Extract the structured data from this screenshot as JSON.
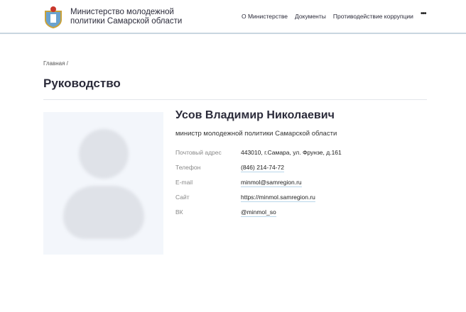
{
  "header": {
    "brand": "Министерство молодежной политики Самарской области",
    "brand_line1": "Министерство молодежной",
    "brand_line2": "политики Самарской области",
    "nav": [
      "О Министерстве",
      "Документы",
      "Противодействие коррупции"
    ],
    "more": "•••"
  },
  "breadcrumb": "Главная /",
  "page_title": "Руководство",
  "person": {
    "name": "Усов Владимир Николаевич",
    "position": "министр молодежной политики Самарской области",
    "contacts": [
      {
        "label": "Почтовый адрес",
        "value": "443010, г.Самара, ул. Фрунзе, д.161"
      },
      {
        "label": "Телефон",
        "value": "(846) 214-74-72"
      },
      {
        "label": "E-mail",
        "value": "minmol@samregion.ru"
      },
      {
        "label": "Сайт",
        "value": "https://minmol.samregion.ru"
      },
      {
        "label": "ВК",
        "value": "@minmol_so"
      }
    ]
  }
}
